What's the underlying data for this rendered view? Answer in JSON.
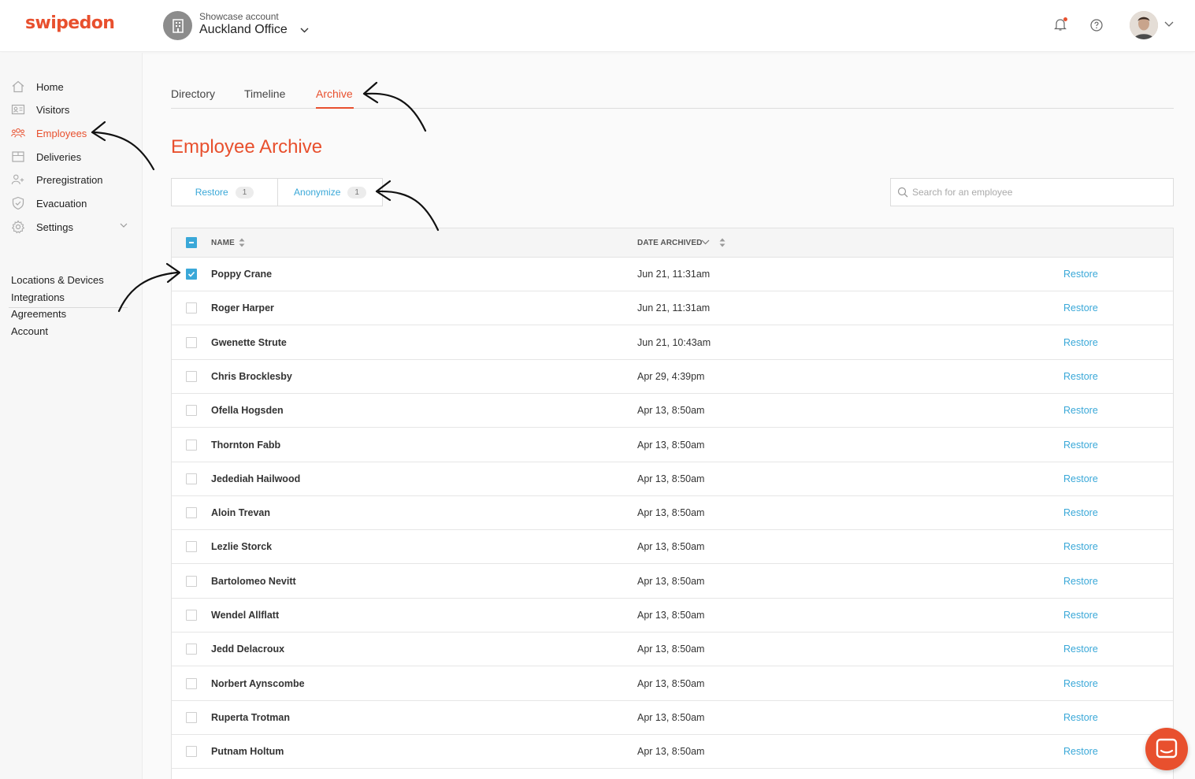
{
  "brand": {
    "logo_text": "swipedon",
    "accent": "#e8502e",
    "link_color": "#3aa8d8"
  },
  "header": {
    "account_label": "Showcase account",
    "account_name": "Auckland Office",
    "icons": [
      "building-icon",
      "bell-icon",
      "help-icon",
      "avatar",
      "chevron-down-icon"
    ]
  },
  "sidebar": {
    "items": [
      {
        "label": "Home",
        "icon": "home-icon"
      },
      {
        "label": "Visitors",
        "icon": "visitor-card-icon"
      },
      {
        "label": "Employees",
        "icon": "people-icon",
        "active": true
      },
      {
        "label": "Deliveries",
        "icon": "box-icon"
      },
      {
        "label": "Preregistration",
        "icon": "add-user-icon"
      },
      {
        "label": "Evacuation",
        "icon": "shield-icon"
      },
      {
        "label": "Settings",
        "icon": "gear-icon"
      }
    ],
    "links": [
      "Locations & Devices",
      "Integrations",
      "Agreements",
      "Account"
    ]
  },
  "tabs": [
    {
      "label": "Directory"
    },
    {
      "label": "Timeline"
    },
    {
      "label": "Archive",
      "active": true
    }
  ],
  "page_title": "Employee Archive",
  "actions": {
    "restore_label": "Restore",
    "restore_count": "1",
    "anonymize_label": "Anonymize",
    "anonymize_count": "1"
  },
  "search": {
    "placeholder": "Search for an employee"
  },
  "table": {
    "columns": {
      "name": "NAME",
      "date": "DATE ARCHIVED"
    },
    "action_label": "Restore",
    "rows": [
      {
        "name": "Poppy Crane",
        "date": "Jun 21, 11:31am",
        "checked": true
      },
      {
        "name": "Roger Harper",
        "date": "Jun 21, 11:31am",
        "checked": false
      },
      {
        "name": "Gwenette Strute",
        "date": "Jun 21, 10:43am",
        "checked": false
      },
      {
        "name": "Chris Brocklesby",
        "date": "Apr 29, 4:39pm",
        "checked": false
      },
      {
        "name": "Ofella Hogsden",
        "date": "Apr 13, 8:50am",
        "checked": false
      },
      {
        "name": "Thornton Fabb",
        "date": "Apr 13, 8:50am",
        "checked": false
      },
      {
        "name": "Jedediah Hailwood",
        "date": "Apr 13, 8:50am",
        "checked": false
      },
      {
        "name": "Aloin Trevan",
        "date": "Apr 13, 8:50am",
        "checked": false
      },
      {
        "name": "Lezlie Storck",
        "date": "Apr 13, 8:50am",
        "checked": false
      },
      {
        "name": "Bartolomeo Nevitt",
        "date": "Apr 13, 8:50am",
        "checked": false
      },
      {
        "name": "Wendel Allflatt",
        "date": "Apr 13, 8:50am",
        "checked": false
      },
      {
        "name": "Jedd Delacroux",
        "date": "Apr 13, 8:50am",
        "checked": false
      },
      {
        "name": "Norbert Aynscombe",
        "date": "Apr 13, 8:50am",
        "checked": false
      },
      {
        "name": "Ruperta Trotman",
        "date": "Apr 13, 8:50am",
        "checked": false
      },
      {
        "name": "Putnam Holtum",
        "date": "Apr 13, 8:50am",
        "checked": false
      }
    ]
  }
}
